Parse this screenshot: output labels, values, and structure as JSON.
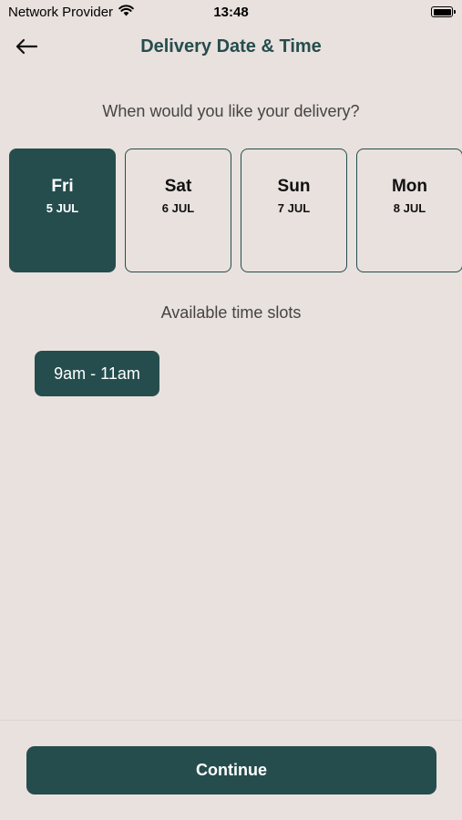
{
  "status_bar": {
    "carrier": "Network Provider",
    "time": "13:48",
    "wifi_icon": "wifi-icon",
    "battery_icon": "battery-icon"
  },
  "header": {
    "title": "Delivery Date & Time",
    "back_icon": "arrow-left-icon"
  },
  "prompt": "When would you like your delivery?",
  "dates": [
    {
      "day": "Fri",
      "date": "5 JUL",
      "selected": true
    },
    {
      "day": "Sat",
      "date": "6 JUL",
      "selected": false
    },
    {
      "day": "Sun",
      "date": "7 JUL",
      "selected": false
    },
    {
      "day": "Mon",
      "date": "8 JUL",
      "selected": false
    }
  ],
  "slots_label": "Available time slots",
  "slots": [
    {
      "label": "9am - 11am"
    }
  ],
  "continue_label": "Continue",
  "colors": {
    "background": "#e8e1dd",
    "accent": "#264d4d"
  }
}
